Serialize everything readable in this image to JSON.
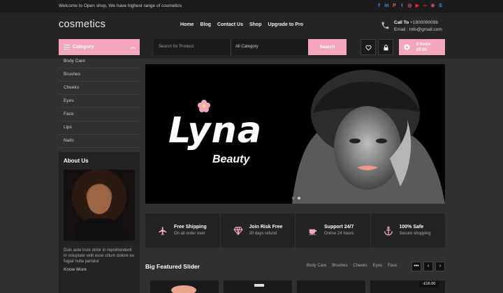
{
  "topbar": {
    "welcome": "Welcome to Open shop, We have highest range of cosmetics",
    "social_icons": [
      "facebook-icon",
      "linkedin-icon",
      "pinterest-icon",
      "twitter-icon",
      "instagram-icon",
      "youtube-icon",
      "lastfm-icon",
      "dribbble-icon",
      "skype-icon"
    ],
    "social_glyphs": [
      "f",
      "in",
      "P",
      "t",
      "◎",
      "▶",
      "∞",
      "⊕",
      "S"
    ]
  },
  "header": {
    "logo": "cosmetics",
    "nav": [
      "Home",
      "Blog",
      "Contact Us",
      "Shop",
      "Upgrade to Pro"
    ],
    "call_label": "Call To",
    "phone": "+1800090098",
    "email": "Email : Info@gmail.com"
  },
  "category": {
    "label": "Category",
    "items": [
      "Body Care",
      "Brushes",
      "Cheeks",
      "Eyes",
      "Face",
      "Lips",
      "Nails"
    ]
  },
  "search": {
    "placeholder": "Search for Product",
    "category_value": "All Category",
    "button": "Search"
  },
  "cart": {
    "items_label": "0 Items",
    "total": "£0.00"
  },
  "about": {
    "title": "About Us",
    "text": "Duis aute irure dolor in reprehenderit in voluptate velit esse cillum dolore eu fugiat nulla pariatur",
    "more": "Know More"
  },
  "hero": {
    "title": "Lyna",
    "subtitle": "Beauty"
  },
  "features": [
    {
      "title": "Free Shipping",
      "sub": "On all order over"
    },
    {
      "title": "Join Risk Free",
      "sub": "30 days refund"
    },
    {
      "title": "Support 24/7",
      "sub": "Online 24 hours"
    },
    {
      "title": "100% Safe",
      "sub": "Secure shopping"
    }
  ],
  "slider": {
    "title": "Big Featured Slider",
    "tabs": [
      "Body Care",
      "Brushes",
      "Cheeks",
      "Eyes",
      "Face"
    ],
    "more": "•••",
    "prev": "‹",
    "next": "›",
    "price": "-£16.00"
  },
  "colors": {
    "accent": "#f4a6bd",
    "bg": "#303030",
    "dark": "#1b1b1b"
  }
}
